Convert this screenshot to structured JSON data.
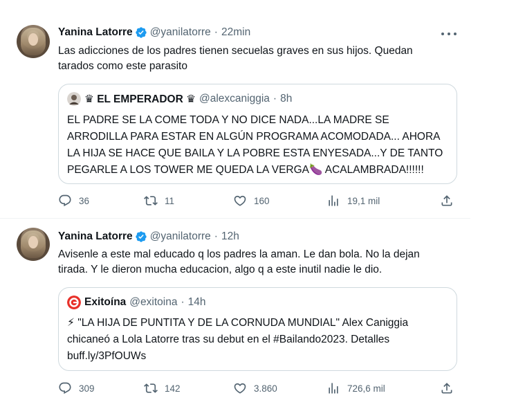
{
  "tweets": [
    {
      "author": "Yanina Latorre",
      "handle": "@yanilatorre",
      "time": "22min",
      "text_lines": [
        "Las adicciones de los padres tienen secuelas graves en sus hijos. Quedan",
        "tarados como este parasito"
      ],
      "quote": {
        "author": "♛ EL EMPERADOR ♛",
        "handle": "@alexcaniggia",
        "time": "8h",
        "text_lines": [
          "EL PADRE SE LA COME TODA Y NO DICE NADA...LA MADRE SE",
          "ARRODILLA PARA ESTAR EN ALGÚN PROGRAMA ACOMODADA... AHORA",
          "LA HIJA SE HACE QUE BAILA Y LA POBRE ESTA ENYESADA...Y DE TANTO",
          "PEGARLE A LOS TOWER ME QUEDA LA VERGA🍆 ACALAMBRADA!!!!!!"
        ]
      },
      "stats": {
        "replies": "36",
        "retweets": "11",
        "likes": "160",
        "views": "19,1 mil"
      }
    },
    {
      "author": "Yanina Latorre",
      "handle": "@yanilatorre",
      "time": "12h",
      "text_lines": [
        "Avisenle a este mal educado q los padres la aman. Le dan bola. No la dejan",
        "tirada. Y le dieron mucha educacion, algo q a este inutil nadie le dio."
      ],
      "quote": {
        "author": "Exitoína",
        "handle": "@exitoina",
        "time": "14h",
        "text_lines": [
          "⚡ \"LA HIJA DE PUNTITA Y DE LA CORNUDA MUNDIAL\" Alex Caniggia",
          "chicaneó a Lola Latorre tras su debut en el #Bailando2023. Detalles",
          "buff.ly/3PfOUWs"
        ]
      },
      "stats": {
        "replies": "309",
        "retweets": "142",
        "likes": "3.860",
        "views": "726,6 mil"
      }
    }
  ],
  "colors": {
    "text": "#0f1419",
    "secondary": "#536471",
    "verified": "#1d9bf0",
    "border": "#cfd9de",
    "exitoina_brand": "#e8312a"
  },
  "icons": [
    "verified-badge-icon",
    "more-icon",
    "reply-icon",
    "retweet-icon",
    "like-icon",
    "views-icon",
    "share-icon"
  ]
}
